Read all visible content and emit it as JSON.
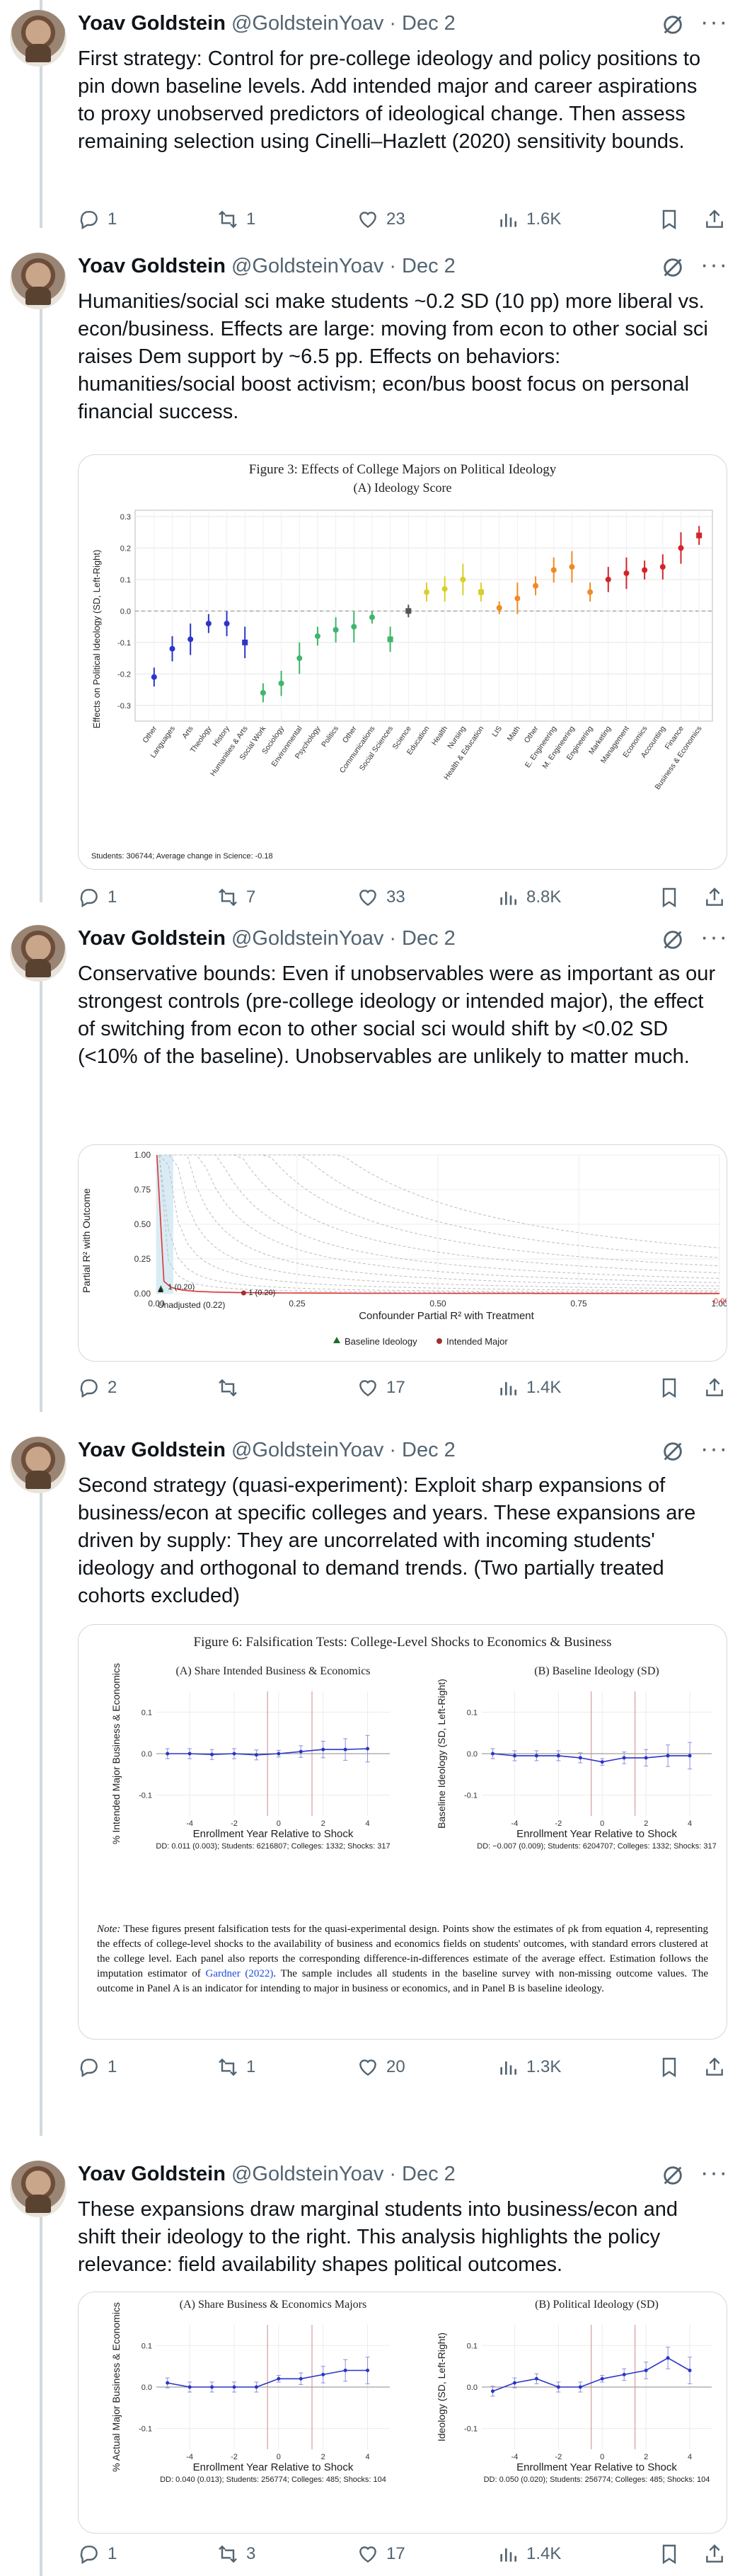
{
  "author": {
    "name": "Yoav Goldstein",
    "handle": "@GoldsteinYoav",
    "separator": "·",
    "date": "Dec 2"
  },
  "tweets": [
    {
      "text": "First strategy: Control for pre-college ideology and policy positions to pin down baseline levels. Add intended major and career aspirations to proxy unobserved predictors of ideological change. Then assess remaining selection using Cinelli–Hazlett (2020) sensitivity bounds.",
      "replies": "1",
      "reposts": "1",
      "likes": "23",
      "views": "1.6K"
    },
    {
      "text": "Humanities/social sci make students ~0.2 SD (10 pp) more liberal vs. econ/business. Effects are large: moving from econ to other social sci raises Dem support by ~6.5 pp. Effects on behaviors: humanities/social boost activism; econ/bus boost focus on personal financial success.",
      "replies": "1",
      "reposts": "7",
      "likes": "33",
      "views": "8.8K"
    },
    {
      "text": "Conservative bounds: Even if unobservables were as important as our strongest controls (pre-college ideology or intended major), the effect of switching from econ to other social sci would shift by <0.02 SD (<10% of the baseline). Unobservables are unlikely to matter much.",
      "replies": "2",
      "reposts": "",
      "likes": "17",
      "views": "1.4K"
    },
    {
      "text": "Second strategy (quasi-experiment): Exploit sharp expansions of business/econ at specific colleges and years. These expansions are driven by supply: They are uncorrelated with incoming students' ideology and orthogonal to demand trends. (Two partially treated cohorts excluded)",
      "replies": "1",
      "reposts": "1",
      "likes": "20",
      "views": "1.3K"
    },
    {
      "text": "These expansions draw marginal students into business/econ and shift their ideology to the right. This analysis highlights the policy relevance: field availability shapes political outcomes.",
      "replies": "1",
      "reposts": "3",
      "likes": "17",
      "views": "1.4K"
    }
  ],
  "icons": [
    "grok-icon",
    "more-icon",
    "reply-icon",
    "repost-icon",
    "like-icon",
    "views-icon",
    "bookmark-icon",
    "share-icon"
  ],
  "colors": {
    "muted": "#536471",
    "border": "#cfd9de"
  },
  "chart_data": [
    {
      "type": "scatter",
      "title": "Figure 3: Effects of College Majors on Political Ideology",
      "subtitle": "(A) Ideology Score",
      "ylabel": "Effects on Political Ideology (SD, Left-Right)",
      "ylim": [
        -0.35,
        0.32
      ],
      "yticks": [
        "-0.3",
        "-0.2",
        "-0.1",
        "0.0",
        "0.1",
        "0.2",
        "0.3"
      ],
      "footnote": "Students: 306744; Average change in Science: -0.18",
      "categories": [
        "Other",
        "Languages",
        "Arts",
        "Theology",
        "History",
        "Humanities & Arts",
        "Social Work",
        "Sociology",
        "Environmental",
        "Psychology",
        "Politics",
        "Other",
        "Communications",
        "Social Sciences",
        "Science",
        "Education",
        "Health",
        "Nursing",
        "Health & Education",
        "LIS",
        "Math",
        "Other",
        "E. Engineering",
        "M. Engineering",
        "Engineering",
        "Marketing",
        "Management",
        "Economics",
        "Accounting",
        "Finance",
        "Business & Economics"
      ],
      "values": [
        -0.21,
        -0.12,
        -0.09,
        -0.04,
        -0.04,
        -0.1,
        -0.26,
        -0.23,
        -0.15,
        -0.08,
        -0.06,
        -0.05,
        -0.02,
        -0.09,
        0.0,
        0.06,
        0.07,
        0.1,
        0.06,
        0.01,
        0.04,
        0.08,
        0.13,
        0.14,
        0.06,
        0.1,
        0.12,
        0.13,
        0.14,
        0.2,
        0.24,
        0.15
      ],
      "colors": [
        "#2b35c9",
        "#2b35c9",
        "#2b35c9",
        "#2b35c9",
        "#2b35c9",
        "#2b35c9",
        "#3fb56b",
        "#3fb56b",
        "#3fb56b",
        "#3fb56b",
        "#3fb56b",
        "#3fb56b",
        "#3fb56b",
        "#3fb56b",
        "#555555",
        "#d9cf2a",
        "#d9cf2a",
        "#d9cf2a",
        "#d9cf2a",
        "#f08a24",
        "#f08a24",
        "#f08a24",
        "#f08a24",
        "#f08a24",
        "#f08a24",
        "#d4232b",
        "#d4232b",
        "#d4232b",
        "#d4232b",
        "#d4232b",
        "#d4232b"
      ]
    },
    {
      "type": "line",
      "title": "",
      "xlabel": "Confounder Partial R² with Treatment",
      "ylabel": "Partial R² with Outcome",
      "xticks": [
        "0.00",
        "0.25",
        "0.50",
        "0.75",
        "1.00"
      ],
      "yticks": [
        "0.00",
        "0.25",
        "0.50",
        "0.75",
        "1.00"
      ],
      "annotations": [
        "Unadjusted (0.22)",
        "1 (0.20)",
        "1 (0.20)",
        "0.00"
      ],
      "legend": [
        "Baseline Ideology",
        "Intended Major"
      ]
    },
    {
      "type": "line",
      "title": "Figure 6: Falsification Tests: College-Level Shocks to Economics & Business",
      "panels": [
        {
          "title": "(A) Share Intended Business & Economics",
          "ylabel": "% Intended Major Business & Economics",
          "xlabel": "Enrollment Year Relative to Shock",
          "x": [
            -5,
            -4,
            -3,
            -2,
            -1,
            0,
            1,
            2,
            3,
            4
          ],
          "y": [
            0.0,
            0.0,
            -0.002,
            0.0,
            -0.003,
            0.0,
            0.005,
            0.01,
            0.01,
            0.012
          ],
          "yticks": [
            "0.1",
            "0.0",
            "-0.1"
          ],
          "xticks": [
            "-4",
            "-2",
            "0",
            "2",
            "4"
          ],
          "footnote": "DD: 0.011 (0.003); Students: 6216807; Colleges: 1332; Shocks: 317"
        },
        {
          "title": "(B) Baseline Ideology (SD)",
          "ylabel": "Baseline Ideology (SD, Left-Right)",
          "xlabel": "Enrollment Year Relative to Shock",
          "x": [
            -5,
            -4,
            -3,
            -2,
            -1,
            0,
            1,
            2,
            3,
            4
          ],
          "y": [
            0.0,
            -0.005,
            -0.005,
            -0.005,
            -0.01,
            -0.02,
            -0.01,
            -0.01,
            -0.005,
            -0.005
          ],
          "yticks": [
            "0.1",
            "0.0",
            "-0.1"
          ],
          "xticks": [
            "-4",
            "-2",
            "0",
            "2",
            "4"
          ],
          "footnote": "DD: −0.007 (0.009); Students: 6204707; Colleges: 1332; Shocks: 317"
        }
      ],
      "note_label": "Note:",
      "note_1": "These figures present falsification tests for the quasi-experimental design. Points show the estimates of ρk from equation 4, representing the effects of college-level shocks to the availability of business and economics fields on students' outcomes, with standard errors clustered at the college level. Each panel also reports the corresponding difference-in-differences estimate of the average effect. Estimation follows the imputation estimator of ",
      "note_link": "Gardner (2022)",
      "note_2": ". The sample includes all students in the baseline survey with non-missing outcome values. The outcome in Panel A is an indicator for intending to major in business or economics, and in Panel B is baseline ideology."
    },
    {
      "type": "line",
      "title": "",
      "panels": [
        {
          "title": "(A) Share Business & Economics Majors",
          "ylabel": "% Actual Major Business & Economics",
          "xlabel": "Enrollment Year Relative to Shock",
          "x": [
            -5,
            -4,
            -3,
            -2,
            -1,
            0,
            1,
            2,
            3,
            4
          ],
          "y": [
            0.01,
            0.0,
            0.0,
            0.0,
            0.0,
            0.02,
            0.02,
            0.03,
            0.04,
            0.04
          ],
          "yticks": [
            "0.1",
            "0.0",
            "-0.1"
          ],
          "xticks": [
            "-4",
            "-2",
            "0",
            "2",
            "4"
          ],
          "footnote": "DD: 0.040 (0.013); Students: 256774; Colleges: 485; Shocks: 104"
        },
        {
          "title": "(B) Political Ideology (SD)",
          "ylabel": "Ideology (SD, Left-Right)",
          "xlabel": "Enrollment Year Relative to Shock",
          "x": [
            -5,
            -4,
            -3,
            -2,
            -1,
            0,
            1,
            2,
            3,
            4
          ],
          "y": [
            -0.01,
            0.01,
            0.02,
            0.0,
            0.0,
            0.02,
            0.03,
            0.04,
            0.07,
            0.04
          ],
          "yticks": [
            "0.1",
            "0.0",
            "-0.1"
          ],
          "xticks": [
            "-4",
            "-2",
            "0",
            "2",
            "4"
          ],
          "footnote": "DD: 0.050 (0.020); Students: 256774; Colleges: 485; Shocks: 104"
        }
      ]
    }
  ]
}
